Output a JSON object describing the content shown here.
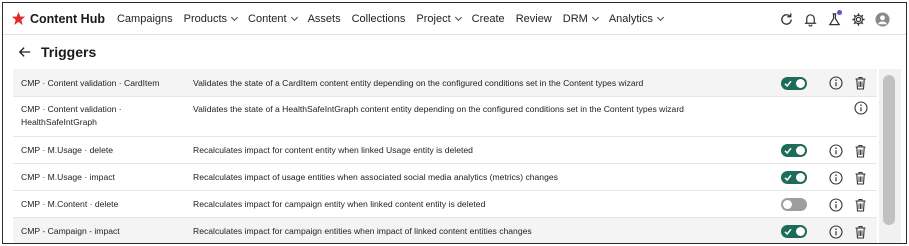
{
  "app": {
    "name": "Content Hub",
    "brand_color": "#e0262a"
  },
  "nav": {
    "items": [
      {
        "label": "Campaigns",
        "dropdown": false
      },
      {
        "label": "Products",
        "dropdown": true
      },
      {
        "label": "Content",
        "dropdown": true
      },
      {
        "label": "Assets",
        "dropdown": false
      },
      {
        "label": "Collections",
        "dropdown": false
      },
      {
        "label": "Project",
        "dropdown": true
      },
      {
        "label": "Create",
        "dropdown": false
      },
      {
        "label": "Review",
        "dropdown": false
      },
      {
        "label": "DRM",
        "dropdown": true
      },
      {
        "label": "Analytics",
        "dropdown": true
      }
    ],
    "right_icons": [
      "refresh-icon",
      "bell-icon",
      "flask-icon",
      "gear-icon",
      "user-avatar-icon"
    ]
  },
  "header": {
    "title": "Triggers"
  },
  "colors": {
    "toggle_on": "#1e6b5a",
    "toggle_off": "#9e9e9e"
  },
  "triggers": [
    {
      "name_lines": [
        "CMP · Content validation · CardItem"
      ],
      "description": "Validates the state of a CardItem content entity depending on the configured conditions set in the Content types wizard",
      "enabled": true,
      "has_toggle": true,
      "has_delete": true
    },
    {
      "name_lines": [
        "CMP · Content validation ·",
        "HealthSafeIntGraph"
      ],
      "description": "Validates the state of a HealthSafeIntGraph content entity depending on the configured conditions set in the Content types wizard",
      "enabled": null,
      "has_toggle": false,
      "has_delete": false
    },
    {
      "name_lines": [
        "CMP · M.Usage · delete"
      ],
      "description": "Recalculates impact for content entity when linked Usage entity is deleted",
      "enabled": true,
      "has_toggle": true,
      "has_delete": true
    },
    {
      "name_lines": [
        "CMP · M.Usage · impact"
      ],
      "description": "Recalculates impact of usage entities when associated social media analytics (metrics) changes",
      "enabled": true,
      "has_toggle": true,
      "has_delete": true
    },
    {
      "name_lines": [
        "CMP · M.Content · delete"
      ],
      "description": "Recalculates impact for campaign entity when linked content entity is deleted",
      "enabled": false,
      "has_toggle": true,
      "has_delete": true
    },
    {
      "name_lines": [
        "CMP - Campaign - impact"
      ],
      "description": "Recalculates impact for campaign entities when impact of linked content entities changes",
      "enabled": true,
      "has_toggle": true,
      "has_delete": true
    }
  ]
}
